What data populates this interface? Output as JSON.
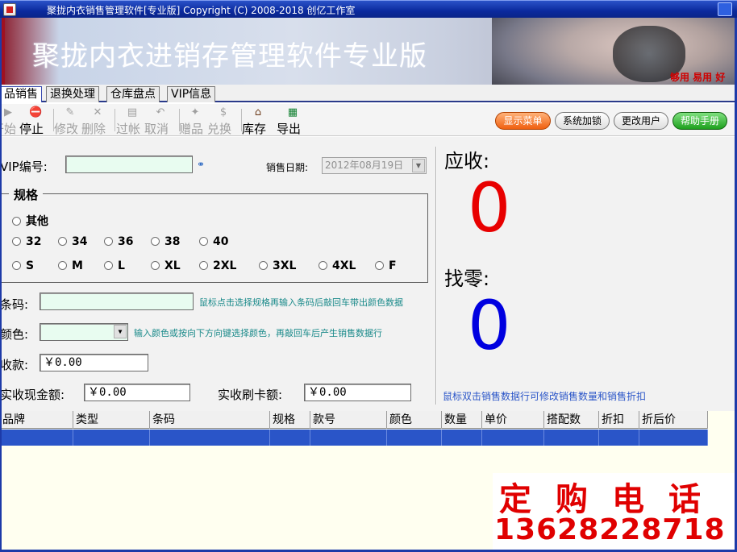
{
  "window": {
    "title": "聚拢内衣销售管理软件[专业版] Copyright (C) 2008-2018 创亿工作室"
  },
  "banner": {
    "slogan": "聚拢内衣进销存管理软件专业版",
    "tag": "够用  易用  好"
  },
  "tabs": [
    {
      "label": "品销售",
      "active": true
    },
    {
      "label": "退换处理",
      "active": false
    },
    {
      "label": "仓库盘点",
      "active": false
    },
    {
      "label": "VIP信息",
      "active": false
    }
  ],
  "toolbar": {
    "buttons": [
      {
        "label": "开始",
        "icon": "play-icon",
        "glyph": "▶",
        "enabled": false
      },
      {
        "label": "停止",
        "icon": "stop-icon",
        "glyph": "⛔",
        "enabled": true
      },
      {
        "label": "修改",
        "icon": "edit-icon",
        "glyph": "✎",
        "enabled": false
      },
      {
        "label": "删除",
        "icon": "delete-icon",
        "glyph": "✕",
        "enabled": false
      },
      {
        "label": "过帐",
        "icon": "post-icon",
        "glyph": "▤",
        "enabled": false
      },
      {
        "label": "取消",
        "icon": "undo-icon",
        "glyph": "↶",
        "enabled": false
      },
      {
        "label": "赠品",
        "icon": "gift-icon",
        "glyph": "✦",
        "enabled": false
      },
      {
        "label": "兑换",
        "icon": "dollar-icon",
        "glyph": "$",
        "enabled": false
      },
      {
        "label": "库存",
        "icon": "home-icon",
        "glyph": "⌂",
        "enabled": true
      },
      {
        "label": "导出",
        "icon": "excel-icon",
        "glyph": "▦",
        "enabled": true
      }
    ],
    "pills": {
      "show_menu": "显示菜单",
      "system_lock": "系统加锁",
      "change_user": "更改用户",
      "help": "帮助手册"
    }
  },
  "form": {
    "vip_label": "VIP编号:",
    "vip_value": "",
    "sale_date_label": "销售日期:",
    "sale_date_value": "2012年08月19日",
    "spec_legend": "规格",
    "spec_row1": [
      "其他"
    ],
    "spec_row2": [
      "32",
      "34",
      "36",
      "38",
      "40"
    ],
    "spec_row3": [
      "S",
      "M",
      "L",
      "XL",
      "2XL",
      "3XL",
      "4XL",
      "F"
    ],
    "barcode_label": "条码:",
    "barcode_value": "",
    "barcode_hint": "鼠标点击选择规格再输入条码后敲回车带出颜色数据",
    "color_label": "颜色:",
    "color_value": "",
    "color_hint": "输入颜色或按向下方向键选择颜色，再敲回车后产生销售数据行",
    "payment_label": "收款:",
    "payment_value": "￥0.00",
    "cash_label": "实收现金额:",
    "cash_value": "￥0.00",
    "card_label": "实收刷卡额:",
    "card_value": "￥0.00"
  },
  "summary": {
    "due_label": "应收:",
    "due_value": "0",
    "change_label": "找零:",
    "change_value": "0",
    "hint": "鼠标双击销售数据行可修改销售数量和销售折扣"
  },
  "table": {
    "columns": [
      "品牌",
      "类型",
      "条码",
      "规格",
      "款号",
      "颜色",
      "数量",
      "单价",
      "搭配数",
      "折扣",
      "折后价"
    ],
    "rows": [
      [
        "",
        "",
        "",
        "",
        "",
        "",
        "",
        "",
        "",
        "",
        ""
      ]
    ]
  },
  "ad": {
    "line1": "定购电话",
    "line2": "13628228718"
  },
  "colors": {
    "accent": "#2a55c8",
    "due": "#e80000",
    "change": "#0000e0",
    "ad": "#e00000"
  }
}
